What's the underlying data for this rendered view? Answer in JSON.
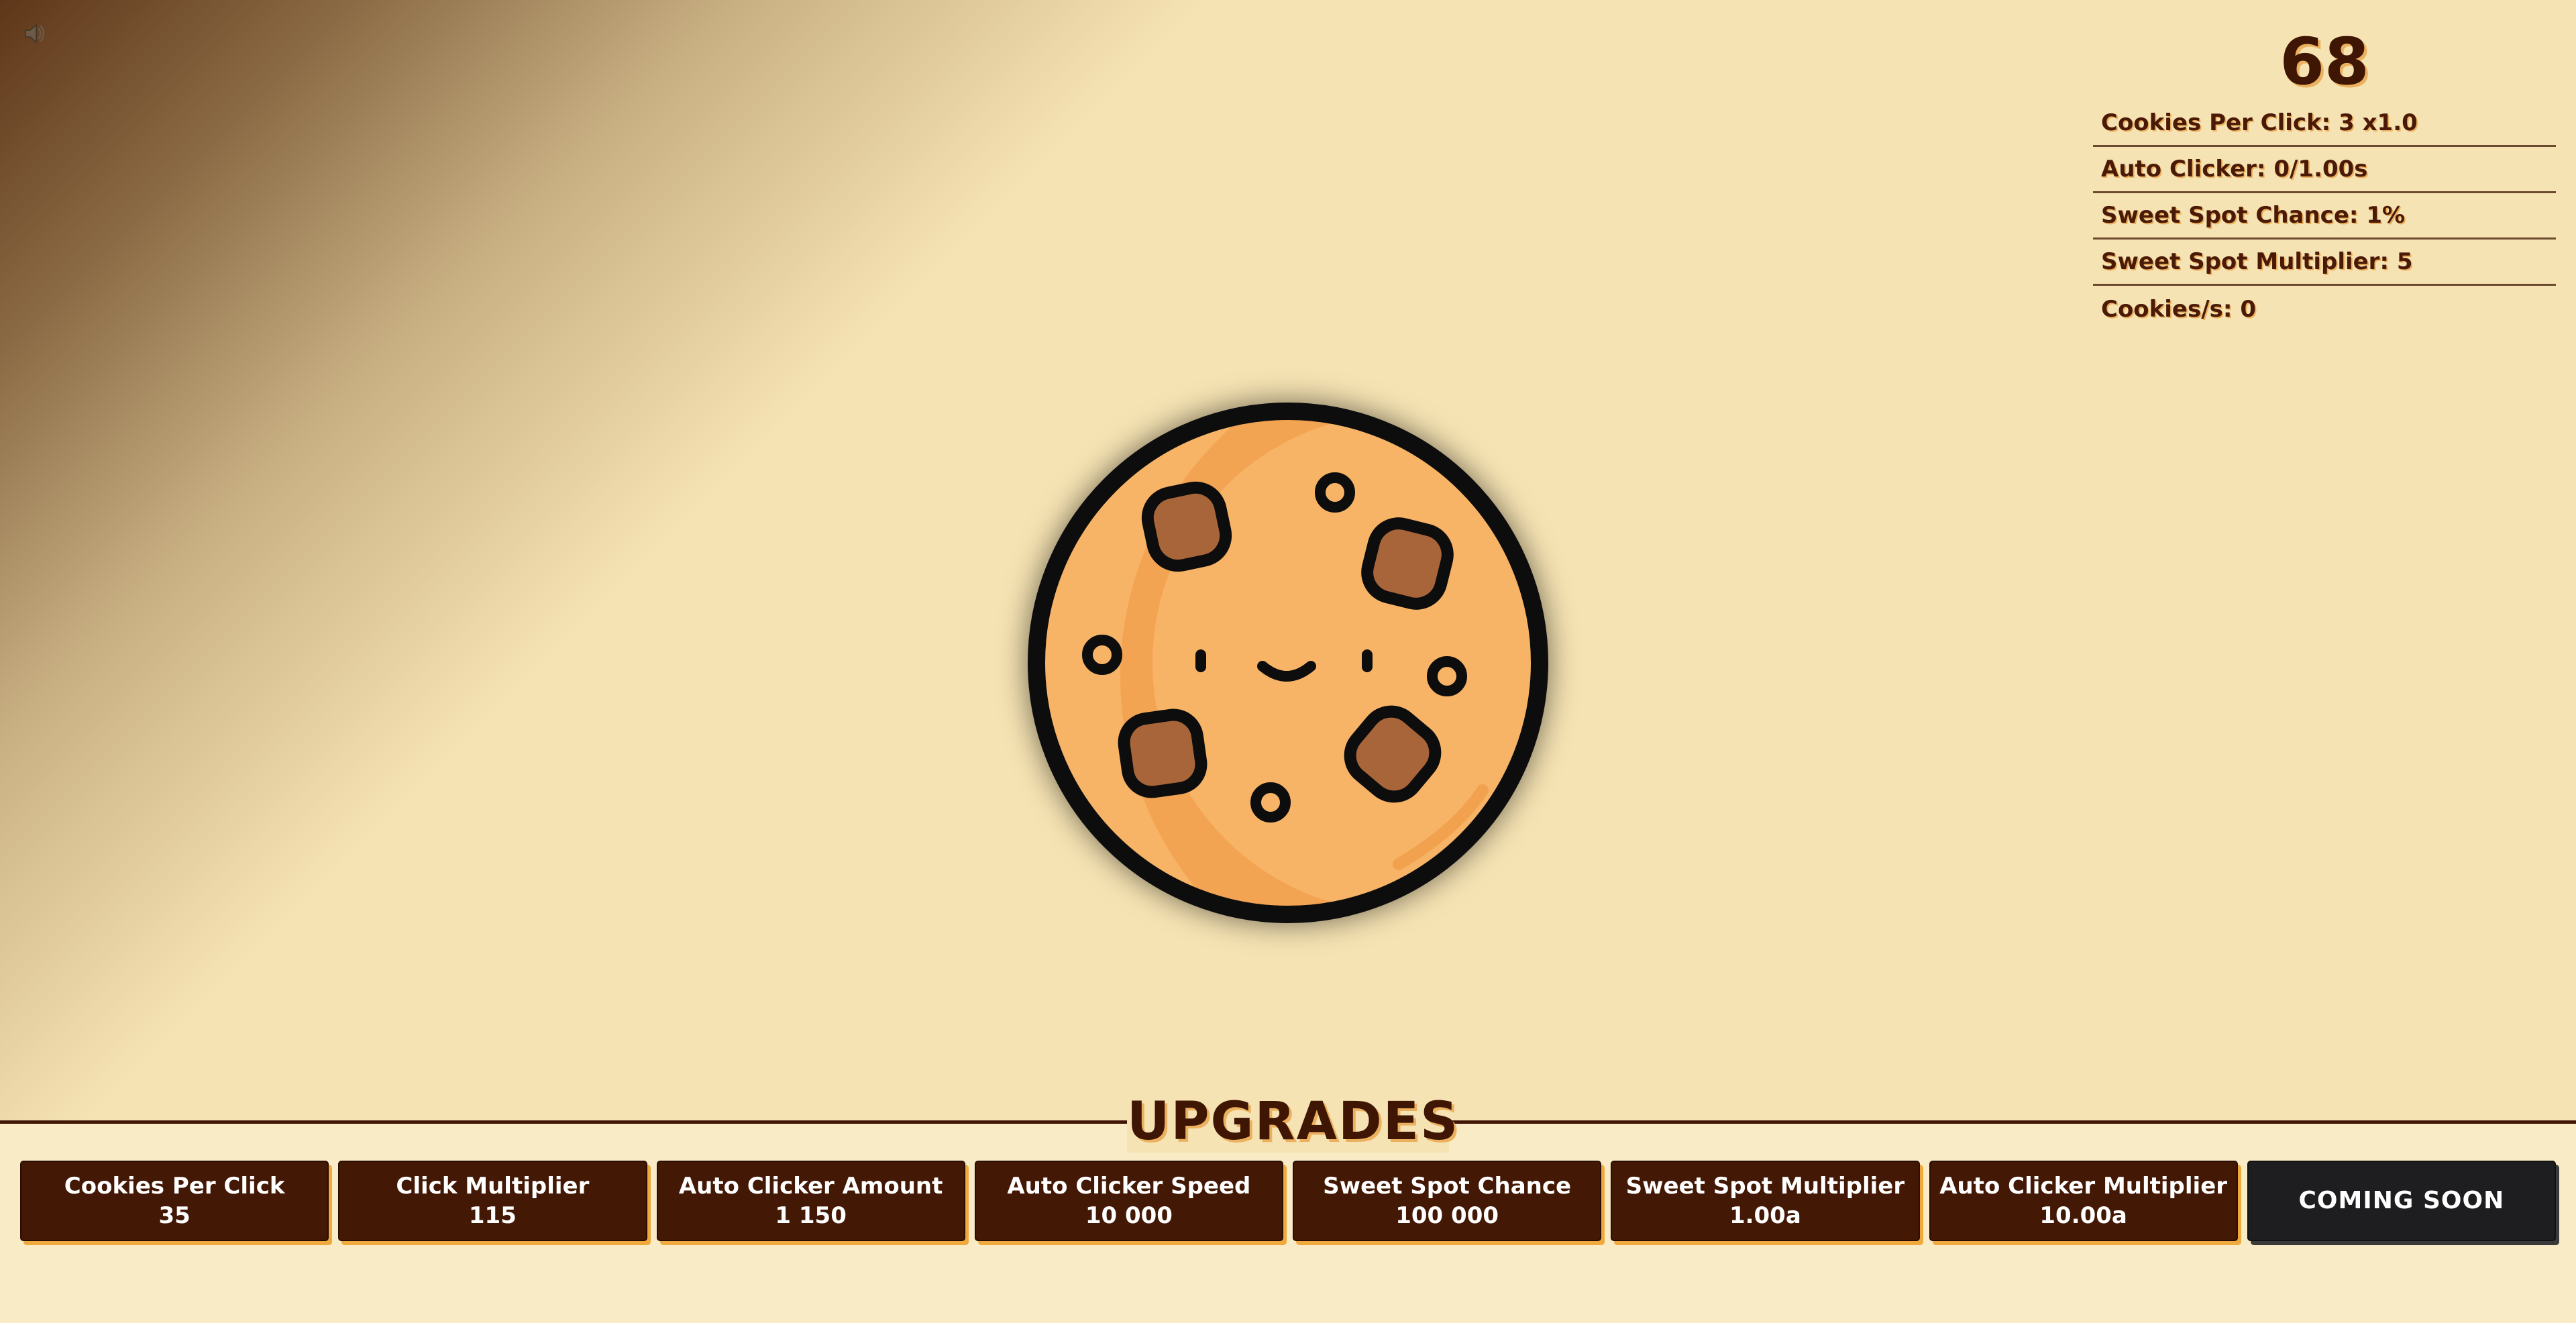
{
  "sound": {
    "icon": "speaker-icon"
  },
  "stats": {
    "cookie_count": "68",
    "rows": [
      {
        "label": "Cookies Per Click: 3 x1.0"
      },
      {
        "label": "Auto Clicker: 0/1.00s"
      },
      {
        "label": "Sweet Spot Chance: 1%"
      },
      {
        "label": "Sweet Spot Multiplier: 5"
      },
      {
        "label": "Cookies/s: 0"
      }
    ]
  },
  "cookie": {
    "icon": "cookie-icon"
  },
  "upgrades": {
    "title": "UPGRADES",
    "items": [
      {
        "name": "Cookies Per Click",
        "cost": "35"
      },
      {
        "name": "Click Multiplier",
        "cost": "115"
      },
      {
        "name": "Auto Clicker Amount",
        "cost": "1 150"
      },
      {
        "name": "Auto Clicker Speed",
        "cost": "10 000"
      },
      {
        "name": "Sweet Spot Chance",
        "cost": "100 000"
      },
      {
        "name": "Sweet Spot Multiplier",
        "cost": "1.00a"
      },
      {
        "name": "Auto Clicker Multiplier",
        "cost": "10.00a"
      }
    ],
    "coming_soon": "COMING SOON"
  },
  "colors": {
    "background": "#f6e3b3",
    "text": "#4a1a06",
    "button": "#431805",
    "button_shadow": "#f0a93c",
    "disabled_button": "#1e1e20",
    "cookie_dough": "#f8b466",
    "cookie_outline": "#0d0d0d"
  }
}
